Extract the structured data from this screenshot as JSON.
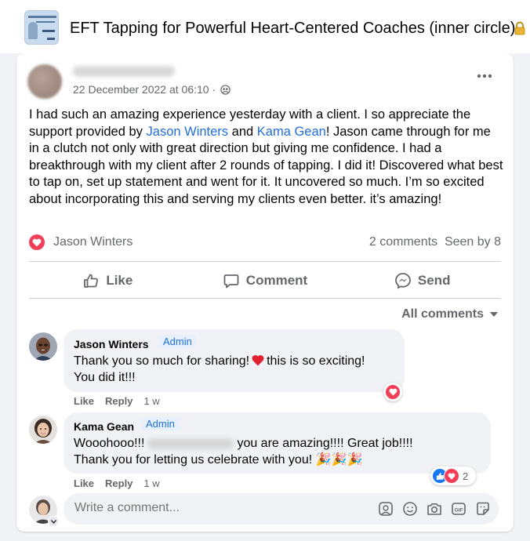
{
  "group": {
    "title": "EFT Tapping for Powerful Heart-Centered Coaches (inner circle)"
  },
  "post": {
    "timestamp": "22 December 2022 at 06:10 ·",
    "text_1": "I had such an amazing experience yesterday with a client.  I so appreciate the support provided by ",
    "mention_1": "Jason Winters",
    "text_2": " and ",
    "mention_2": "Kama Gean",
    "text_3": "!  Jason came through for me in a clutch not only with great direction but giving me confidence. I had a breakthrough with my client after 2 rounds of tapping. I did it!  Discovered what best to tap on, set up statement and went for it. It uncovered so much. I’m so excited about incorporating this and serving my clients even better. it’s amazing!",
    "reactor": "Jason Winters",
    "comments_count": "2 comments",
    "seen_by": "Seen by 8"
  },
  "actions": {
    "like": "Like",
    "comment": "Comment",
    "send": "Send"
  },
  "comments_filter": "All comments",
  "comments": [
    {
      "name": "Jason Winters",
      "badge": "Admin",
      "line1_a": "Thank you so much for sharing!",
      "line1_b": "this is so exciting!",
      "line2": "You did it!!!",
      "like": "Like",
      "reply": "Reply",
      "time": "1 w"
    },
    {
      "name": "Kama Gean",
      "badge": "Admin",
      "line1_a": "Wooohooo!!!",
      "line1_b": "you are amazing!!!! Great job!!!!",
      "line2": "Thank you for letting us celebrate with you! 🎉🎉🎉",
      "like": "Like",
      "reply": "Reply",
      "time": "1 w",
      "reaction_count": "2"
    }
  ],
  "composer": {
    "placeholder": "Write a comment..."
  },
  "colors": {
    "link": "#216fdb",
    "love": "#f33e58",
    "like": "#1877f2",
    "muted": "#65676b"
  }
}
